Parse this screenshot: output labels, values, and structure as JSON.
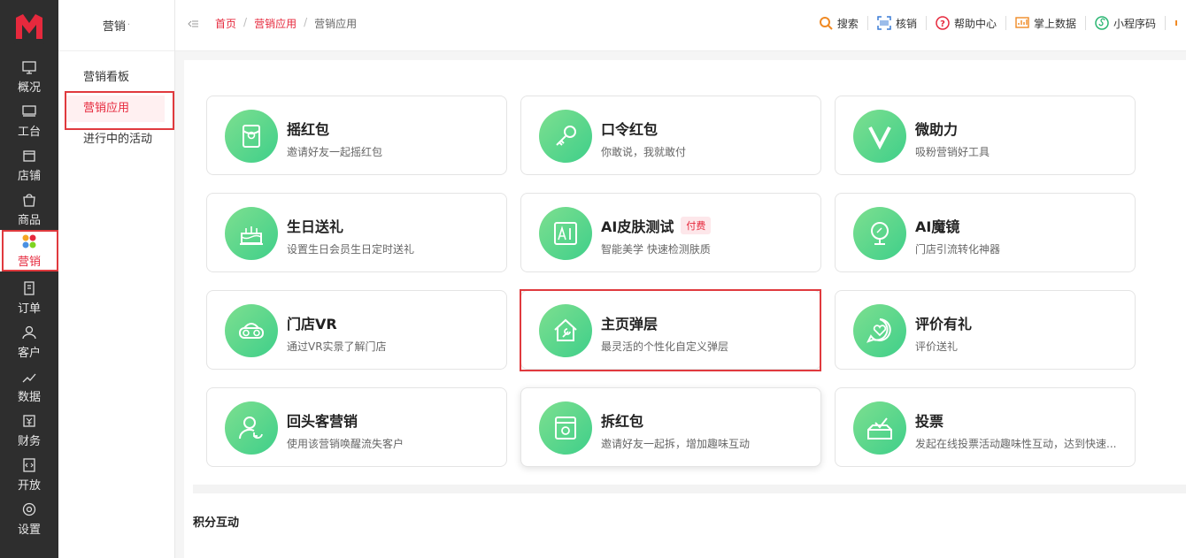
{
  "rail": {
    "items": [
      {
        "label": "概况",
        "icon": "monitor-icon"
      },
      {
        "label": "工台",
        "icon": "desktop-icon"
      },
      {
        "label": "店铺",
        "icon": "store-icon"
      },
      {
        "label": "商品",
        "icon": "shopping-bag-icon"
      },
      {
        "label": "营销",
        "icon": "marketing-icon",
        "active": true
      },
      {
        "label": "订单",
        "icon": "order-icon"
      },
      {
        "label": "客户",
        "icon": "user-icon"
      },
      {
        "label": "数据",
        "icon": "chart-icon"
      },
      {
        "label": "财务",
        "icon": "finance-icon"
      },
      {
        "label": "开放",
        "icon": "code-icon"
      },
      {
        "label": "设置",
        "icon": "gear-icon"
      }
    ]
  },
  "sidebar": {
    "title": "营销",
    "items": [
      {
        "label": "营销看板"
      },
      {
        "label": "营销应用",
        "active": true
      },
      {
        "label": "进行中的活动"
      }
    ]
  },
  "header": {
    "breadcrumb": [
      "首页",
      "营销应用",
      "营销应用"
    ],
    "tools": [
      {
        "label": "搜索",
        "icon": "search-icon",
        "color": "#f08a24"
      },
      {
        "label": "核销",
        "icon": "scan-icon",
        "color": "#3a7bd5"
      },
      {
        "label": "帮助中心",
        "icon": "help-icon",
        "color": "#e6293d"
      },
      {
        "label": "掌上数据",
        "icon": "data-chart-icon",
        "color": "#f08a24"
      },
      {
        "label": "小程序码",
        "icon": "miniprogram-icon",
        "color": "#2bb673"
      }
    ]
  },
  "cards": [
    {
      "title": "摇红包",
      "desc": "邀请好友一起摇红包",
      "icon": "red-envelope-icon"
    },
    {
      "title": "口令红包",
      "desc": "你敢说，我就敢付",
      "icon": "key-icon"
    },
    {
      "title": "微助力",
      "desc": "吸粉营销好工具",
      "icon": "v-letter-icon"
    },
    {
      "title": "生日送礼",
      "desc": "设置生日会员生日定时送礼",
      "icon": "cake-icon"
    },
    {
      "title": "AI皮肤测试",
      "desc": "智能美学 快速检测肤质",
      "icon": "ai-icon",
      "badge": "付费"
    },
    {
      "title": "AI魔镜",
      "desc": "门店引流转化神器",
      "icon": "mirror-icon"
    },
    {
      "title": "门店VR",
      "desc": "通过VR实景了解门店",
      "icon": "vr-glasses-icon"
    },
    {
      "title": "主页弹层",
      "desc": "最灵活的个性化自定义弹层",
      "icon": "home-wrench-icon"
    },
    {
      "title": "评价有礼",
      "desc": "评价送礼",
      "icon": "heart-chat-icon"
    },
    {
      "title": "回头客营销",
      "desc": "使用该营销唤醒流失客户",
      "icon": "returning-user-icon"
    },
    {
      "title": "拆红包",
      "desc": "邀请好友一起拆，增加趣味互动",
      "icon": "open-envelope-icon"
    },
    {
      "title": "投票",
      "desc": "发起在线投票活动趣味性互动，达到快速...",
      "icon": "vote-box-icon"
    }
  ],
  "section": {
    "title": "积分互动"
  },
  "colors": {
    "accent": "#e6293d",
    "rail_bg": "#2e2e2e",
    "icon_green": "#3fcf8a"
  }
}
